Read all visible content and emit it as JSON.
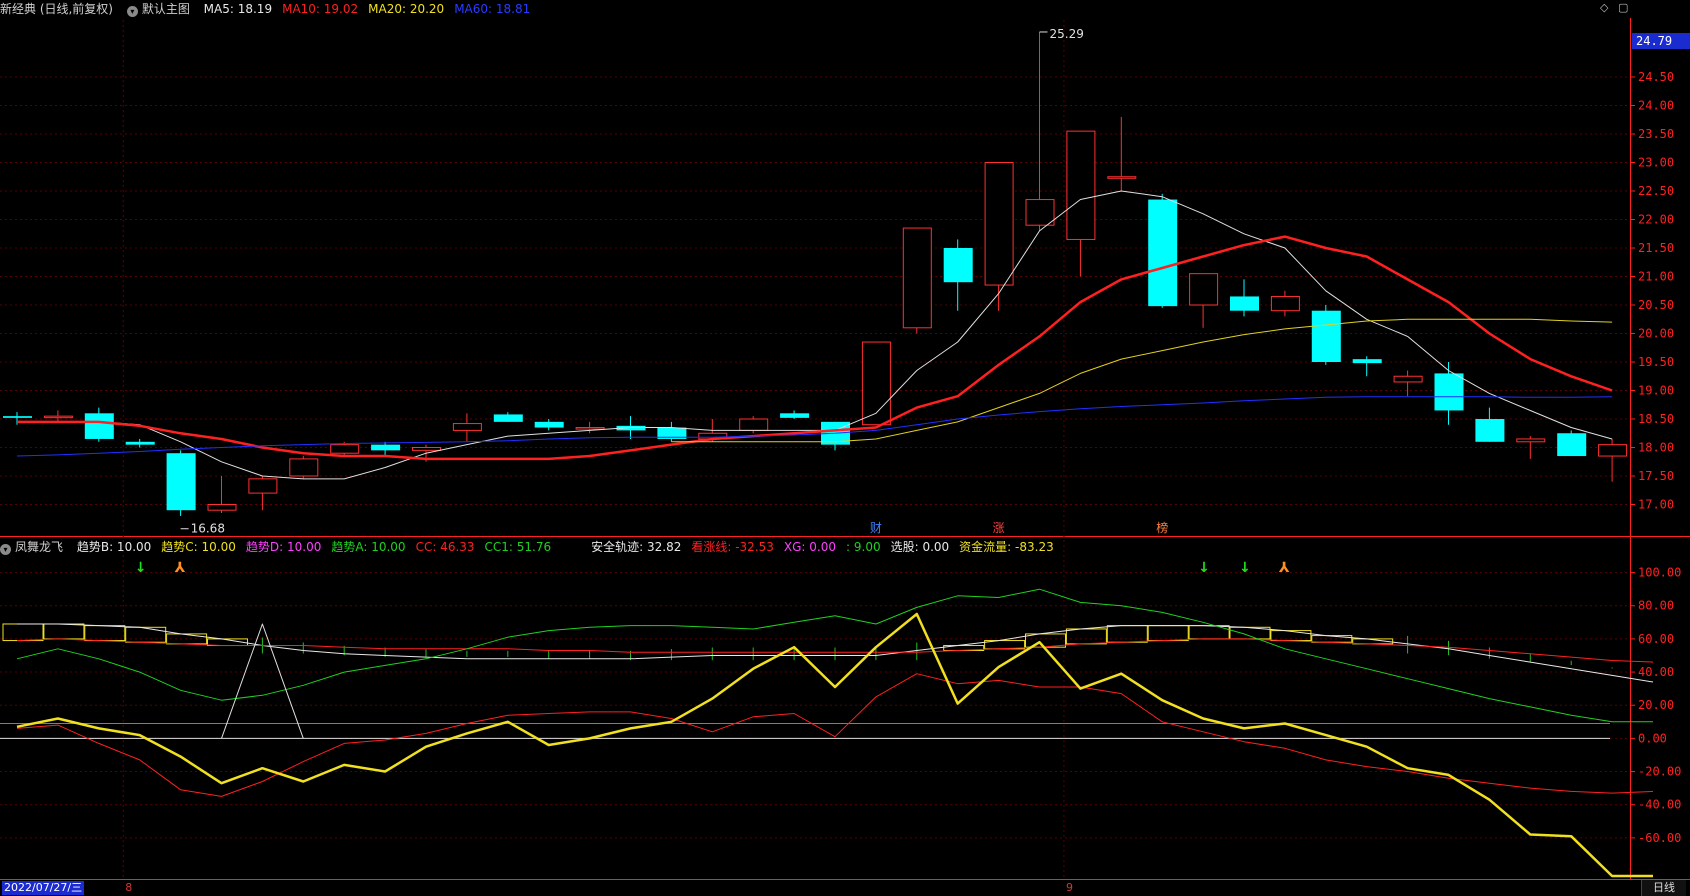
{
  "main_header": {
    "stock": "新经典 (日线,前复权)",
    "template": "默认主图",
    "ma": [
      {
        "label": "MA5: 18.19",
        "color": "#e8e8e8"
      },
      {
        "label": "MA10: 19.02",
        "color": "#ff2020"
      },
      {
        "label": "MA20: 20.20",
        "color": "#f0e020"
      },
      {
        "label": "MA60: 18.81",
        "color": "#2a3cff"
      }
    ]
  },
  "indicator_header": {
    "name": "凤舞龙飞",
    "items": [
      {
        "label": "趋势B: 10.00",
        "color": "#e8e8e8"
      },
      {
        "label": "趋势C: 10.00",
        "color": "#f0e020"
      },
      {
        "label": "趋势D: 10.00",
        "color": "#ff40ff"
      },
      {
        "label": "趋势A: 10.00",
        "color": "#20d020"
      },
      {
        "label": "CC: 46.33",
        "color": "#ff2020"
      },
      {
        "label": "CC1: 51.76",
        "color": "#20d020"
      },
      {
        "label": "安全轨迹: 32.82",
        "color": "#e8e8e8"
      },
      {
        "label": "看涨线: -32.53",
        "color": "#ff2020"
      },
      {
        "label": "XG: 0.00",
        "color": "#ff40ff"
      },
      {
        "label": ": 9.00",
        "color": "#20d020"
      },
      {
        "label": "选股: 0.00",
        "color": "#e8e8e8"
      },
      {
        "label": "资金流量: -83.23",
        "color": "#f0e020"
      }
    ]
  },
  "colors": {
    "up": "#ff3030",
    "down": "#00ffff",
    "grid": "#5a0000",
    "axis": "#ff2020",
    "text": "#ff2020"
  },
  "last_price_tag": "24.79",
  "events": [
    {
      "index": 21,
      "label": "财",
      "color": "#4080ff"
    },
    {
      "index": 24,
      "label": "涨",
      "color": "#ff4040"
    },
    {
      "index": 28,
      "label": "榜",
      "color": "#ff8040"
    }
  ],
  "arrows": [
    {
      "index": 3,
      "type": "down"
    },
    {
      "index": 4,
      "type": "up"
    },
    {
      "index": 29,
      "type": "down"
    },
    {
      "index": 30,
      "type": "down"
    },
    {
      "index": 31,
      "type": "up"
    }
  ],
  "time_axis": {
    "first": "2022/07/27/三",
    "ticks": [
      {
        "index": 3,
        "label": "8"
      },
      {
        "index": 26,
        "label": "9"
      }
    ],
    "period": "日线"
  },
  "chart_data": [
    {
      "type": "candlestick",
      "ylim": [
        16.5,
        25.5
      ],
      "yticks": [
        "17.00",
        "17.50",
        "18.00",
        "18.50",
        "19.00",
        "19.50",
        "20.00",
        "20.50",
        "21.00",
        "21.50",
        "22.00",
        "22.50",
        "23.00",
        "23.50",
        "24.00",
        "24.50"
      ],
      "annotations": [
        {
          "index": 4,
          "value": 16.68,
          "label": "16.68"
        },
        {
          "index": 25,
          "value": 25.29,
          "label": "25.29"
        }
      ],
      "candles": [
        {
          "o": 18.55,
          "h": 18.62,
          "l": 18.4,
          "c": 18.52
        },
        {
          "o": 18.55,
          "h": 18.65,
          "l": 18.45,
          "c": 18.55
        },
        {
          "o": 18.6,
          "h": 18.7,
          "l": 18.1,
          "c": 18.15
        },
        {
          "o": 18.1,
          "h": 18.15,
          "l": 18.0,
          "c": 18.05
        },
        {
          "o": 17.9,
          "h": 17.95,
          "l": 16.8,
          "c": 16.9
        },
        {
          "o": 16.9,
          "h": 17.5,
          "l": 16.85,
          "c": 17.0
        },
        {
          "o": 17.2,
          "h": 17.5,
          "l": 16.9,
          "c": 17.45
        },
        {
          "o": 17.5,
          "h": 17.85,
          "l": 17.45,
          "c": 17.8
        },
        {
          "o": 17.9,
          "h": 18.1,
          "l": 17.85,
          "c": 18.05
        },
        {
          "o": 18.05,
          "h": 18.1,
          "l": 17.85,
          "c": 17.95
        },
        {
          "o": 17.95,
          "h": 18.05,
          "l": 17.75,
          "c": 18.0
        },
        {
          "o": 18.3,
          "h": 18.6,
          "l": 18.1,
          "c": 18.42
        },
        {
          "o": 18.58,
          "h": 18.62,
          "l": 18.45,
          "c": 18.45
        },
        {
          "o": 18.45,
          "h": 18.5,
          "l": 18.3,
          "c": 18.35
        },
        {
          "o": 18.35,
          "h": 18.45,
          "l": 18.25,
          "c": 18.35
        },
        {
          "o": 18.38,
          "h": 18.55,
          "l": 18.15,
          "c": 18.3
        },
        {
          "o": 18.35,
          "h": 18.45,
          "l": 18.1,
          "c": 18.15
        },
        {
          "o": 18.15,
          "h": 18.5,
          "l": 18.1,
          "c": 18.25
        },
        {
          "o": 18.3,
          "h": 18.55,
          "l": 18.25,
          "c": 18.5
        },
        {
          "o": 18.6,
          "h": 18.65,
          "l": 18.5,
          "c": 18.52
        },
        {
          "o": 18.45,
          "h": 18.45,
          "l": 17.95,
          "c": 18.05
        },
        {
          "o": 18.4,
          "h": 19.85,
          "l": 18.4,
          "c": 19.85
        },
        {
          "o": 20.1,
          "h": 21.85,
          "l": 20.0,
          "c": 21.85
        },
        {
          "o": 21.5,
          "h": 21.65,
          "l": 20.4,
          "c": 20.9
        },
        {
          "o": 20.85,
          "h": 23.0,
          "l": 20.4,
          "c": 23.0
        },
        {
          "o": 21.9,
          "h": 25.29,
          "l": 21.8,
          "c": 22.35
        },
        {
          "o": 21.65,
          "h": 23.55,
          "l": 21.0,
          "c": 23.55
        },
        {
          "o": 22.75,
          "h": 23.8,
          "l": 22.5,
          "c": 22.75
        },
        {
          "o": 22.35,
          "h": 22.45,
          "l": 20.45,
          "c": 20.48
        },
        {
          "o": 20.5,
          "h": 21.05,
          "l": 20.1,
          "c": 21.05
        },
        {
          "o": 20.65,
          "h": 20.95,
          "l": 20.3,
          "c": 20.4
        },
        {
          "o": 20.4,
          "h": 20.75,
          "l": 20.3,
          "c": 20.65
        },
        {
          "o": 20.4,
          "h": 20.5,
          "l": 19.45,
          "c": 19.5
        },
        {
          "o": 19.55,
          "h": 19.6,
          "l": 19.25,
          "c": 19.48
        },
        {
          "o": 19.15,
          "h": 19.35,
          "l": 18.9,
          "c": 19.25
        },
        {
          "o": 19.3,
          "h": 19.5,
          "l": 18.4,
          "c": 18.65
        },
        {
          "o": 18.5,
          "h": 18.7,
          "l": 18.1,
          "c": 18.1
        },
        {
          "o": 18.1,
          "h": 18.2,
          "l": 17.8,
          "c": 18.15
        },
        {
          "o": 18.25,
          "h": 18.3,
          "l": 17.85,
          "c": 17.85
        },
        {
          "o": 17.85,
          "h": 18.15,
          "l": 17.4,
          "c": 18.05
        }
      ],
      "series": [
        {
          "name": "MA5",
          "color": "#e0e0e0",
          "width": 1,
          "values": [
            18.45,
            18.45,
            18.45,
            18.4,
            18.1,
            17.75,
            17.5,
            17.45,
            17.45,
            17.65,
            17.9,
            18.05,
            18.2,
            18.25,
            18.3,
            18.35,
            18.35,
            18.3,
            18.3,
            18.3,
            18.3,
            18.6,
            19.35,
            19.85,
            20.7,
            21.8,
            22.35,
            22.5,
            22.4,
            22.1,
            21.75,
            21.5,
            20.75,
            20.25,
            19.95,
            19.35,
            18.95,
            18.65,
            18.35,
            18.15
          ]
        },
        {
          "name": "MA10",
          "color": "#ff2020",
          "width": 2.5,
          "values": [
            18.45,
            18.45,
            18.45,
            18.38,
            18.25,
            18.15,
            18.0,
            17.9,
            17.85,
            17.85,
            17.8,
            17.8,
            17.8,
            17.8,
            17.85,
            17.95,
            18.05,
            18.15,
            18.2,
            18.25,
            18.3,
            18.35,
            18.7,
            18.9,
            19.45,
            19.95,
            20.55,
            20.95,
            21.15,
            21.35,
            21.55,
            21.7,
            21.5,
            21.35,
            20.95,
            20.55,
            20.0,
            19.55,
            19.25,
            19.0
          ]
        },
        {
          "name": "MA20",
          "color": "#e0d020",
          "width": 1,
          "values": [
            null,
            null,
            null,
            null,
            null,
            null,
            null,
            null,
            null,
            null,
            null,
            null,
            null,
            null,
            null,
            null,
            18.1,
            18.1,
            18.1,
            18.1,
            18.1,
            18.15,
            18.3,
            18.45,
            18.7,
            18.95,
            19.3,
            19.55,
            19.7,
            19.85,
            19.98,
            20.08,
            20.15,
            20.22,
            20.25,
            20.25,
            20.25,
            20.25,
            20.22,
            20.2
          ]
        },
        {
          "name": "MA60",
          "color": "#2030ff",
          "width": 1,
          "values": [
            17.85,
            17.87,
            17.9,
            17.93,
            17.97,
            18.0,
            18.03,
            18.05,
            18.07,
            18.08,
            18.09,
            18.1,
            18.12,
            18.15,
            18.17,
            18.18,
            18.18,
            18.18,
            18.2,
            18.22,
            18.25,
            18.3,
            18.4,
            18.5,
            18.57,
            18.63,
            18.68,
            18.72,
            18.75,
            18.78,
            18.82,
            18.85,
            18.88,
            18.89,
            18.89,
            18.89,
            18.89,
            18.88,
            18.88,
            18.89
          ]
        }
      ]
    },
    {
      "type": "line",
      "ylim": [
        -83,
        110
      ],
      "yticks": [
        "100.00",
        "80.00",
        "60.00",
        "40.00",
        "20.00",
        "0.00",
        "-20.00",
        "-40.00",
        "-60.00"
      ],
      "hlines": [
        {
          "value": 9,
          "color": "#20c020"
        },
        {
          "value": 0,
          "color": "#e0e0e0"
        }
      ],
      "series": [
        {
          "name": "safe",
          "color": "#e8e8e8",
          "width": 1,
          "values": [
            69,
            69,
            68,
            67,
            63,
            60,
            56,
            53,
            51,
            50,
            49,
            48,
            48,
            48,
            48,
            48,
            49,
            50,
            50,
            50,
            50,
            50,
            53,
            56,
            59,
            63,
            66,
            68,
            68,
            68,
            67,
            65,
            62,
            60,
            57,
            54,
            50,
            46,
            42,
            38,
            34
          ]
        },
        {
          "name": "red",
          "color": "#ff2020",
          "width": 1,
          "values": [
            59,
            60,
            59,
            58,
            57,
            56,
            56,
            56,
            55,
            54,
            54,
            54,
            54,
            53,
            53,
            52,
            52,
            52,
            52,
            52,
            52,
            52,
            52,
            53,
            54,
            55,
            57,
            58,
            59,
            60,
            60,
            59,
            58,
            57,
            56,
            55,
            53,
            51,
            49,
            47,
            46
          ]
        },
        {
          "name": "green",
          "color": "#20d020",
          "width": 1,
          "values": [
            48,
            54,
            48,
            40,
            29,
            23,
            26,
            32,
            40,
            44,
            48,
            54,
            61,
            65,
            67,
            68,
            68,
            67,
            66,
            70,
            74,
            69,
            79,
            86,
            85,
            90,
            82,
            80,
            76,
            70,
            63,
            54,
            48,
            42,
            36,
            30,
            24,
            19,
            14,
            10,
            10
          ]
        },
        {
          "name": "CC",
          "color": "#ff2020",
          "width": 1,
          "values": [
            6,
            8,
            -3,
            -13,
            -31,
            -35,
            -26,
            -14,
            -3,
            -1,
            3,
            9,
            14,
            15,
            16,
            16,
            12,
            4,
            13,
            15,
            1,
            25,
            39,
            33,
            35,
            31,
            31,
            27,
            10,
            4,
            -2,
            -6,
            -13,
            -17,
            -20,
            -24,
            -27,
            -30,
            -32,
            -33,
            -32
          ]
        },
        {
          "name": "flow",
          "color": "#f0e020",
          "width": 2.5,
          "values": [
            7,
            12,
            6,
            2,
            -11,
            -27,
            -18,
            -26,
            -16,
            -20,
            -5,
            3,
            10,
            -4,
            0,
            6,
            10,
            24,
            42,
            55,
            31,
            55,
            75,
            21,
            43,
            58,
            30,
            39,
            23,
            12,
            6,
            9,
            2,
            -5,
            -18,
            -22,
            -37,
            -58,
            -59,
            -83,
            -83
          ]
        },
        {
          "name": "spike",
          "color": "#e0e0e0",
          "width": 1,
          "values": [
            null,
            null,
            null,
            null,
            null,
            0,
            69,
            0,
            null,
            null,
            null,
            null,
            null,
            null,
            null,
            null,
            null,
            null,
            null,
            null,
            null,
            null,
            null,
            null,
            null,
            null,
            null,
            null,
            null,
            null,
            null,
            null,
            null,
            null,
            null,
            null,
            null,
            null,
            null,
            null,
            null
          ]
        }
      ]
    }
  ]
}
